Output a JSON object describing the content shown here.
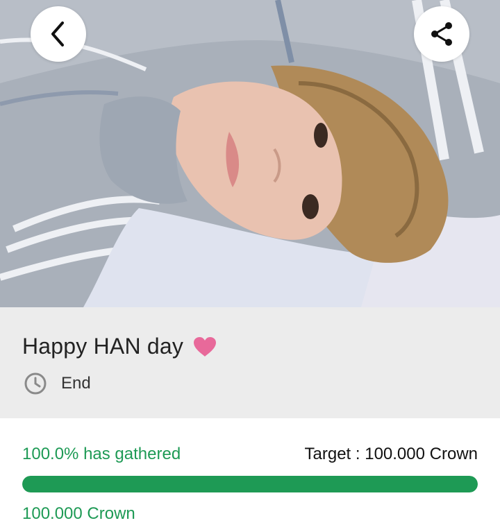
{
  "header": {
    "back_icon": "chevron-left-icon",
    "share_icon": "share-icon"
  },
  "event": {
    "title": "Happy HAN day",
    "title_icon": "heart-icon",
    "status_icon": "clock-icon",
    "status": "End"
  },
  "funding": {
    "gathered_label": "100.0% has gathered",
    "target_label": "Target : 100.000 Crown",
    "progress_fraction": 1.0,
    "amount_label": "100.000 Crown"
  },
  "colors": {
    "accent_green": "#1e9a55",
    "heart_pink": "#e8699a",
    "info_background": "#ececec"
  }
}
